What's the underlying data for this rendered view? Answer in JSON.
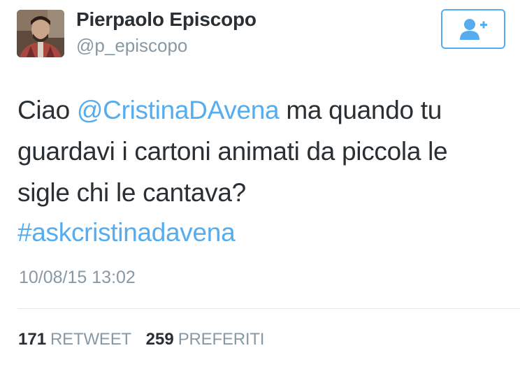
{
  "author": {
    "name": "Pierpaolo Episcopo",
    "handle": "@p_episcopo"
  },
  "follow_button": {
    "icon": "add-user-icon",
    "color": "#55acee"
  },
  "tweet": {
    "line1_prefix": "Ciao ",
    "mention": "@CristinaDAvena",
    "line1_suffix": " ma quando tu",
    "line2": "guardavi i cartoni animati da piccola le",
    "line3": "sigle chi le cantava?",
    "hashtag": "#askcristinadavena",
    "timestamp": "10/08/15 13:02"
  },
  "stats": {
    "retweets_count": "171",
    "retweets_label": "RETWEET",
    "favorites_count": "259",
    "favorites_label": "PREFERITI"
  },
  "colors": {
    "link": "#55acee",
    "text": "#292f33",
    "muted": "#8899a6"
  }
}
